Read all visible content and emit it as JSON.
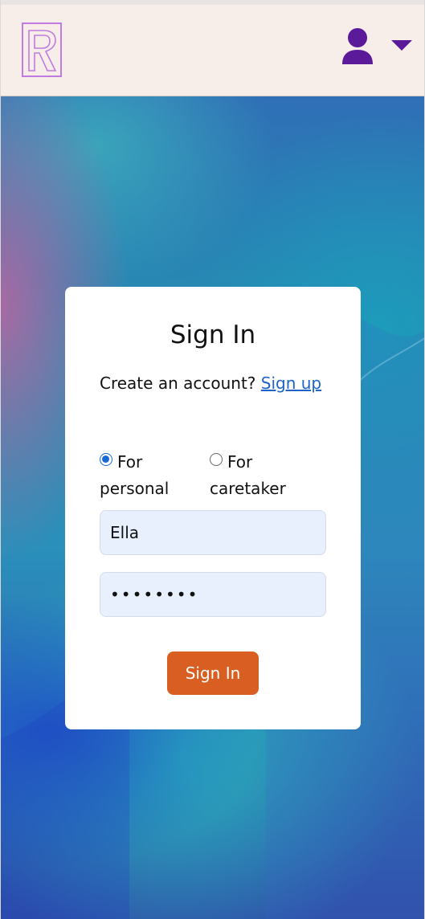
{
  "header": {
    "logo_letter": "R",
    "logo_icon": "r-logo-icon",
    "user_icon": "user-icon",
    "menu_icon": "caret-down-icon",
    "colors": {
      "header_bg": "#f8eee9",
      "icon": "#5a1a99",
      "logo": "#c07ae0"
    }
  },
  "form": {
    "title": "Sign In",
    "create_prompt": "Create an account?",
    "signup_link": "Sign up",
    "account_types": [
      {
        "label": "For personal",
        "selected": true
      },
      {
        "label": "For caretaker",
        "selected": false
      }
    ],
    "username_value": "Ella",
    "password_value": "••••••••",
    "submit_label": "Sign In",
    "colors": {
      "button": "#d85f21",
      "link": "#1e63c8",
      "input_bg": "#e8f0fd"
    }
  }
}
